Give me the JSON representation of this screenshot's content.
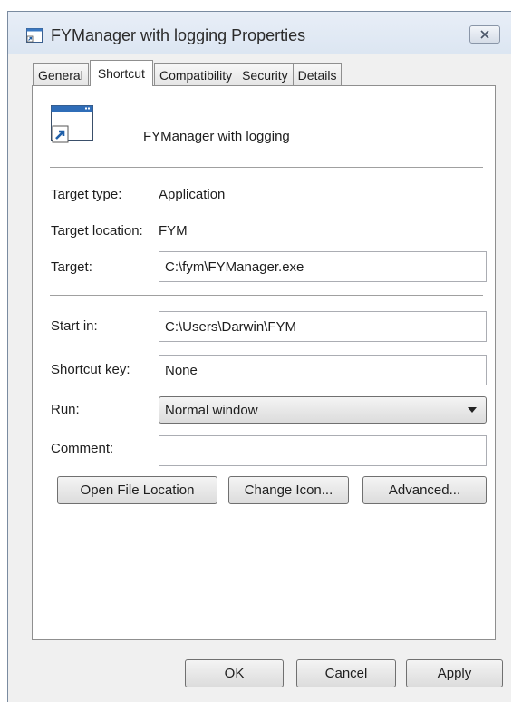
{
  "window": {
    "title": "FYManager with logging Properties",
    "close_icon": "close-x-icon",
    "app_icon": "shortcut-app-icon"
  },
  "tabs": [
    {
      "label": "General",
      "active": false
    },
    {
      "label": "Shortcut",
      "active": true
    },
    {
      "label": "Compatibility",
      "active": false
    },
    {
      "label": "Security",
      "active": false
    },
    {
      "label": "Details",
      "active": false
    }
  ],
  "shortcut": {
    "name": "FYManager with logging",
    "target_type_label": "Target type:",
    "target_type_value": "Application",
    "target_location_label": "Target location:",
    "target_location_value": "FYM",
    "target_label": "Target:",
    "target_value": "C:\\fym\\FYManager.exe",
    "start_in_label": "Start in:",
    "start_in_value": "C:\\Users\\Darwin\\FYM",
    "shortcut_key_label": "Shortcut key:",
    "shortcut_key_value": "None",
    "run_label": "Run:",
    "run_value": "Normal window",
    "comment_label": "Comment:",
    "comment_value": ""
  },
  "actions": {
    "open_file_location": "Open File Location",
    "change_icon": "Change Icon...",
    "advanced": "Advanced..."
  },
  "footer": {
    "ok": "OK",
    "cancel": "Cancel",
    "apply": "Apply"
  }
}
